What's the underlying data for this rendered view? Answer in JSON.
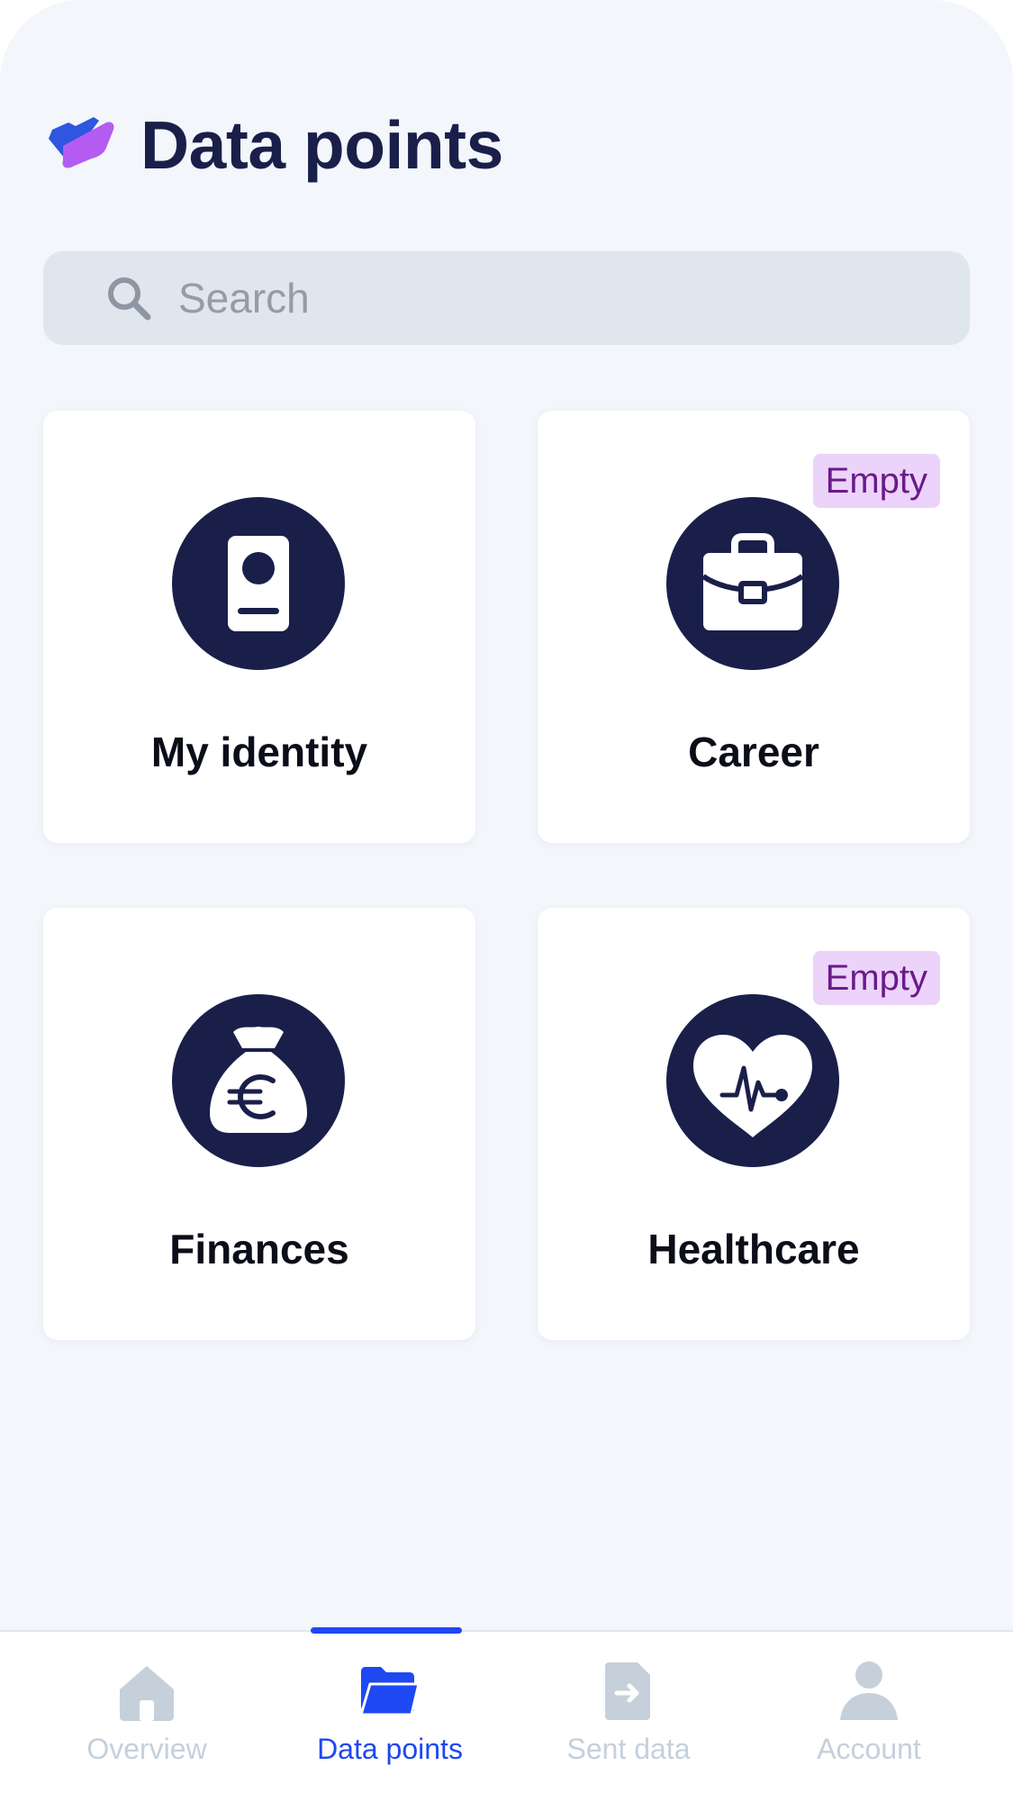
{
  "header": {
    "title": "Data points",
    "logo_icon": "folder-logo-icon"
  },
  "search": {
    "placeholder": "Search",
    "value": "",
    "icon": "search-icon"
  },
  "categories": [
    {
      "label": "My identity",
      "icon": "id-card-icon",
      "badge": ""
    },
    {
      "label": "Career",
      "icon": "briefcase-icon",
      "badge": "Empty"
    },
    {
      "label": "Finances",
      "icon": "money-bag-euro-icon",
      "badge": ""
    },
    {
      "label": "Healthcare",
      "icon": "heart-pulse-icon",
      "badge": "Empty"
    }
  ],
  "bottom_nav": {
    "active_index": 1,
    "items": [
      {
        "label": "Overview",
        "icon": "home-icon"
      },
      {
        "label": "Data points",
        "icon": "folder-icon"
      },
      {
        "label": "Sent data",
        "icon": "sent-document-icon"
      },
      {
        "label": "Account",
        "icon": "user-icon"
      }
    ]
  },
  "colors": {
    "background": "#f3f6fb",
    "primary_dark": "#1a1f4a",
    "accent_blue": "#1e48f2",
    "badge_bg": "#ecd3fa",
    "badge_text": "#6b1a8a",
    "nav_inactive": "#c5d0db",
    "search_bg": "#dfe6ee"
  }
}
